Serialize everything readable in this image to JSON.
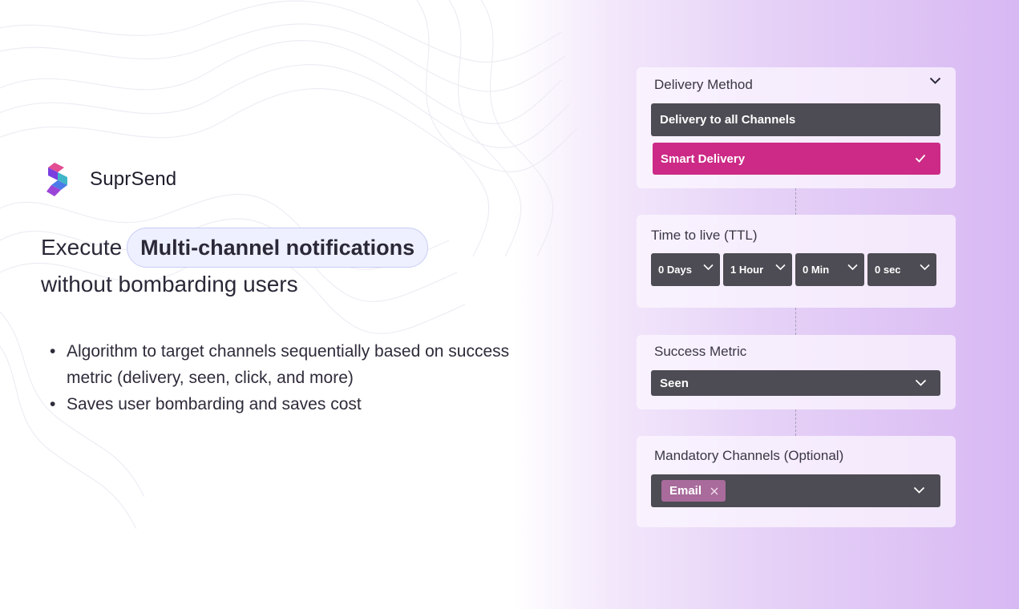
{
  "brand": {
    "name": "SuprSend"
  },
  "headline": {
    "prefix": "Execute",
    "highlight": "Multi-channel notifications",
    "line2": "without bombarding users"
  },
  "bullets": [
    "Algorithm to target channels sequentially based on success metric (delivery, seen, click, and more)",
    "Saves user bombarding and saves cost"
  ],
  "delivery_method": {
    "title": "Delivery Method",
    "options": [
      {
        "label": "Delivery to all Channels",
        "selected": false
      },
      {
        "label": "Smart Delivery",
        "selected": true
      }
    ]
  },
  "ttl": {
    "title": "Time to live (TTL)",
    "fields": [
      {
        "value": "0 Days"
      },
      {
        "value": "1 Hour"
      },
      {
        "value": "0 Min"
      },
      {
        "value": "0 sec"
      }
    ]
  },
  "success_metric": {
    "title": "Success Metric",
    "value": "Seen"
  },
  "mandatory_channels": {
    "title": "Mandatory Channels (Optional)",
    "chips": [
      {
        "label": "Email"
      }
    ]
  },
  "colors": {
    "accent_pink": "#cc2a86",
    "dark_bar": "#4d4b53",
    "chip": "#a86b9b",
    "gradient_end": "#d8b8f3"
  },
  "icons": {
    "logo": "suprsend-logo",
    "dropdown": "chevron-down-icon",
    "check": "check-icon",
    "remove": "close-icon"
  }
}
